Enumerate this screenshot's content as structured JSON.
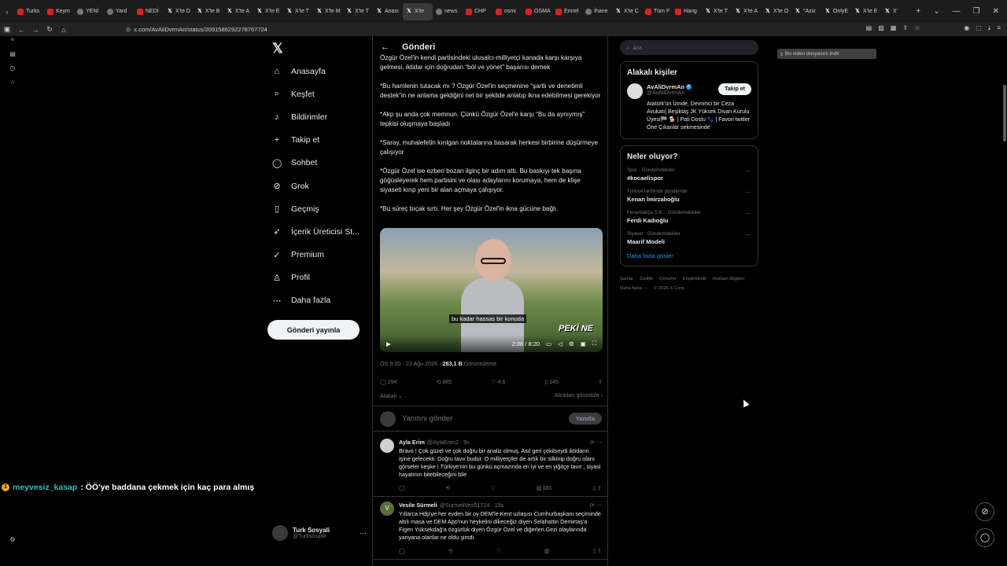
{
  "browser": {
    "tabs": [
      {
        "label": "Turks",
        "icon": "red"
      },
      {
        "label": "Keym",
        "icon": "red"
      },
      {
        "label": "YENİ",
        "icon": "gray"
      },
      {
        "label": "Yard",
        "icon": "gray"
      },
      {
        "label": "NEDİ",
        "icon": "red"
      },
      {
        "label": "X'te D",
        "icon": "x"
      },
      {
        "label": "X'te B",
        "icon": "x"
      },
      {
        "label": "X'te A",
        "icon": "x"
      },
      {
        "label": "X'te E",
        "icon": "x"
      },
      {
        "label": "X'te T",
        "icon": "x"
      },
      {
        "label": "X'te M",
        "icon": "x"
      },
      {
        "label": "X'te T",
        "icon": "x"
      },
      {
        "label": "Anası",
        "icon": "x"
      },
      {
        "label": "X'te",
        "icon": "x",
        "active": true
      },
      {
        "label": "news",
        "icon": "gray"
      },
      {
        "label": "CHP",
        "icon": "red"
      },
      {
        "label": "osmi",
        "icon": "red"
      },
      {
        "label": "OSMA",
        "icon": "red"
      },
      {
        "label": "Emrel",
        "icon": "red"
      },
      {
        "label": "İhane",
        "icon": "gray"
      },
      {
        "label": "X'te C",
        "icon": "x"
      },
      {
        "label": "Tüm F",
        "icon": "red"
      },
      {
        "label": "Hang",
        "icon": "red"
      },
      {
        "label": "X'te T",
        "icon": "x"
      },
      {
        "label": "X'te A",
        "icon": "x"
      },
      {
        "label": "X'te O",
        "icon": "x"
      },
      {
        "label": "\"Aziz",
        "icon": "x"
      },
      {
        "label": "OnlyE",
        "icon": "x"
      },
      {
        "label": "X'te E",
        "icon": "x"
      },
      {
        "label": "X'",
        "icon": "x"
      }
    ],
    "url": "x.com/AvAliDvrmAn/status/2091586292278767724"
  },
  "sidebar": {
    "items": [
      {
        "label": "Anasayfa",
        "icon": "⌂",
        "name": "home-icon"
      },
      {
        "label": "Keşfet",
        "icon": "⌕",
        "name": "search-icon"
      },
      {
        "label": "Bildirimler",
        "icon": "♪",
        "name": "bell-icon"
      },
      {
        "label": "Takip et",
        "icon": "+",
        "name": "follow-icon"
      },
      {
        "label": "Sohbet",
        "icon": "◯",
        "name": "chat-icon"
      },
      {
        "label": "Grok",
        "icon": "⊘",
        "name": "grok-icon"
      },
      {
        "label": "Geçmiş",
        "icon": "▯",
        "name": "bookmark-icon"
      },
      {
        "label": "İçerik Üreticisi St...",
        "icon": "➶",
        "name": "rocket-icon"
      },
      {
        "label": "Premium",
        "icon": "✓",
        "name": "premium-icon"
      },
      {
        "label": "Profil",
        "icon": "♙",
        "name": "profile-icon"
      },
      {
        "label": "Daha fazla",
        "icon": "⋯",
        "name": "more-icon"
      }
    ],
    "post_button": "Gönderi yayınla",
    "account": {
      "name": "Turk Sosyali",
      "handle": "@Turksosyali"
    }
  },
  "main": {
    "title": "Gönderi",
    "paragraphs": [
      "Özgür Özel'in kendi partisindeki ulusalcı-milliyetçi kanada karşı karşıya gelmesi, iktidar için doğrudan “böl ve yönet” başarısı demek",
      "*Bu hamlenin tutacak mı ? Özgür Özel'in seçmenine “şartlı ve denetimli destek”in ne anlama geldiğini net bir şekilde anlatıp ikna edebilmesi gerekiyor",
      "*Akp şu anda çok memnun. Çünkü Özgür Özel'e karşı “Bu da aynıymış” tepkisi oluşmaya başladı",
      "*Saray, muhalefetin kırılgan noktalarına basarak herkesi birbirine düşürmeye çalışıyor",
      "*Özgür Özel ise ezberi bozan ilginç bir adım attı. Bu baskıyı tek başına göğüsleyerek hem partisini ve olası adaylarını korumaya, hem de klişe siyaseti kırıp yeni bir alan açmaya çalışıyor.",
      "*Bu süreç bıçak sırtı. Her şey Özgür Özel'in ikna gücüne bağlı."
    ],
    "video": {
      "caption": "bu kadar hassas bir konuda",
      "time": "2:08 / 8:20",
      "badge": "PEKİ NE"
    },
    "meta": {
      "datetime": "ÖS 9:00 · 23 Ağu 2026 · ",
      "views": "283,1 B",
      "views_label": " Görüntüleme"
    },
    "actions": {
      "replies": "294",
      "reposts": "885",
      "likes": "4,6",
      "bookmarks": "145"
    },
    "related_label": "Alakalı",
    "quotes_label": "Alıntıları görüntüle",
    "reply_placeholder": "Yanıtını gönder",
    "reply_button": "Yanıtla",
    "replies": [
      {
        "name": "Ayla Erim",
        "handle": "@AylaErim2 · 9s",
        "text": "Bravo ! Çok güzel ve çok doğru bir analiz olmuş. Asıl geri çekilseydi iktidarın işine gelecekti. Doğru tavır budur. O milliyetçiler de artık bir silkinip doğru olanı görseler keşke ! Türkiye'nin bu günkü açmazında en iyi ve en yiğitçe tavır , siyasi hayatının bitebileceğini bile",
        "views": "681",
        "avatar": "",
        "color": "#cfcfcf"
      },
      {
        "name": "Vesile Sürmeli",
        "handle": "@SurmeliVes51724 · 15s",
        "text": "Yıllarca Hdp'ye her evden bir oy DEM'le Kent uzlaşısı Cumhurbaşkanı seçiminde altılı masa ve DEM Apo'nun heykelini dikeceğiz diyen Selahattin Demirtaş'a Figen Yüksekdağ'a özgürlük diyen Özgür Özel ve diğerleri.Gezi olaylarında yanyana olanlar ne oldu şimdi.",
        "views": "",
        "avatar": "V",
        "color": "#5a6e3a"
      }
    ]
  },
  "right": {
    "search_placeholder": "Ara",
    "people_title": "Alakalı kişiler",
    "person": {
      "name": "AvAliDvrmAn",
      "handle": "@AvAliDvrmAn",
      "follow": "Takip et",
      "bio": "Atatürk'ün İzinde, Devrimci bir Ceza Avukatı| Beşiktaş JK Yüksek Divan Kurulu Üyesi🏁 🐕 | Pati Dostu 🐾 | Favori twitler Öne Çıkanlar sekmesinde"
    },
    "trends_title": "Neler oluyor?",
    "trends": [
      {
        "category": "Spor · Gündemdekiler",
        "name": "#kocaelispor"
      },
      {
        "category": "Türkiye tarihinde gündemde",
        "name": "Kenan İmirzalıoğlu"
      },
      {
        "category": "Fenerbahçe S.K. · Gündemdekiler",
        "name": "Ferdi Kadıoğlu"
      },
      {
        "category": "Siyaset · Gündemdekiler",
        "name": "Maarif Modeli"
      }
    ],
    "show_more": "Daha fazla göster",
    "footer": [
      "Şartlar",
      "Gizlilik",
      "Çerezler",
      "Erişilebilirlik",
      "Reklam Bilgileri",
      "Daha fazla ···",
      "© 2026 X Corp."
    ]
  },
  "download_bar": "Bu video dosyasını indir",
  "chat_overlay": {
    "badge": "1",
    "user": "meyvesiz_kasap",
    "message": ": ÖÖ'ye baddana çekmek için kaç para almış"
  }
}
